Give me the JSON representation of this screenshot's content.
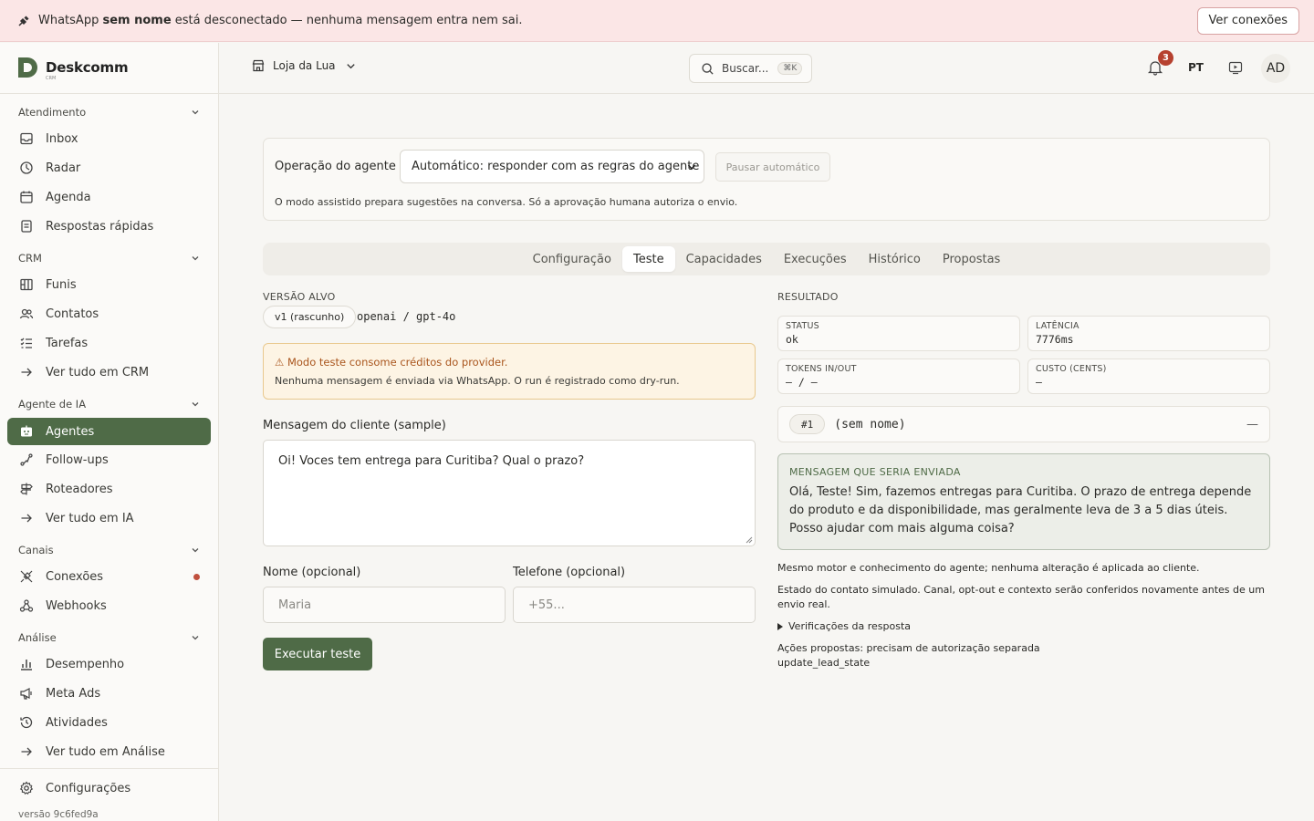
{
  "banner": {
    "prefix": "WhatsApp ",
    "name": "sem nome",
    "suffix": " está desconectado — nenhuma mensagem entra nem sai.",
    "button": "Ver conexões"
  },
  "brand": {
    "name": "Deskcomm",
    "sub": "CRM"
  },
  "sidebar": {
    "sections": [
      {
        "label": "Atendimento",
        "items": [
          {
            "label": "Inbox",
            "icon": "inbox-icon"
          },
          {
            "label": "Radar",
            "icon": "radar-icon"
          },
          {
            "label": "Agenda",
            "icon": "calendar-icon"
          },
          {
            "label": "Respostas rápidas",
            "icon": "document-icon"
          }
        ]
      },
      {
        "label": "CRM",
        "items": [
          {
            "label": "Funis",
            "icon": "kanban-icon"
          },
          {
            "label": "Contatos",
            "icon": "users-icon"
          },
          {
            "label": "Tarefas",
            "icon": "checklist-icon"
          },
          {
            "label": "Ver tudo em CRM",
            "icon": "arrow-right-icon"
          }
        ]
      },
      {
        "label": "Agente de IA",
        "items": [
          {
            "label": "Agentes",
            "icon": "bot-icon",
            "active": true
          },
          {
            "label": "Follow-ups",
            "icon": "route-icon"
          },
          {
            "label": "Roteadores",
            "icon": "signpost-icon"
          },
          {
            "label": "Ver tudo em IA",
            "icon": "arrow-right-icon"
          }
        ]
      },
      {
        "label": "Canais",
        "items": [
          {
            "label": "Conexões",
            "icon": "unplug-icon",
            "alert": true
          },
          {
            "label": "Webhooks",
            "icon": "webhook-icon"
          }
        ]
      },
      {
        "label": "Análise",
        "items": [
          {
            "label": "Desempenho",
            "icon": "bar-chart-icon"
          },
          {
            "label": "Meta Ads",
            "icon": "megaphone-icon"
          },
          {
            "label": "Atividades",
            "icon": "history-icon"
          },
          {
            "label": "Ver tudo em Análise",
            "icon": "arrow-right-icon"
          }
        ]
      }
    ],
    "settings": "Configurações",
    "version": "versão 9c6fed9a"
  },
  "topbar": {
    "store": "Loja da Lua",
    "search_placeholder": "Buscar...",
    "search_shortcut": "⌘K",
    "notifications": "3",
    "lang": "PT",
    "avatar": "AD"
  },
  "operation": {
    "label": "Operação do agente",
    "mode": "Automático: responder com as regras do agente",
    "pause": "Pausar automático",
    "help": "O modo assistido prepara sugestões na conversa. Só a aprovação humana autoriza o envio."
  },
  "tabs": [
    "Configuração",
    "Teste",
    "Capacidades",
    "Execuções",
    "Histórico",
    "Propostas"
  ],
  "active_tab": "Teste",
  "test": {
    "target_label": "VERSÃO ALVO",
    "version_chip": "v1 (rascunho)",
    "model": "openai / gpt-4o",
    "warning_title": "⚠ Modo teste consome créditos do provider.",
    "warning_body": "Nenhuma mensagem é enviada via WhatsApp. O run é registrado como dry-run.",
    "sample_label": "Mensagem do cliente (sample)",
    "sample_value": "Oi! Voces tem entrega para Curitiba? Qual o prazo?",
    "name_label": "Nome (opcional)",
    "name_placeholder": "Maria",
    "phone_label": "Telefone (opcional)",
    "phone_placeholder": "+55...",
    "run_button": "Executar teste"
  },
  "result": {
    "label": "RESULTADO",
    "status_k": "STATUS",
    "status_v": "ok",
    "latency_k": "LATÊNCIA",
    "latency_v": "7776ms",
    "tokens_k": "TOKENS IN/OUT",
    "tokens_v": "— / —",
    "cost_k": "CUSTO (CENTS)",
    "cost_v": "—",
    "run_id": "#1",
    "run_name": "(sem nome)",
    "run_dash": "—",
    "message_label": "MENSAGEM QUE SERIA ENVIADA",
    "message": "Olá, Teste! Sim, fazemos entregas para Curitiba. O prazo de entrega depende do produto e da disponibilidade, mas geralmente leva de 3 a 5 dias úteis. Posso ajudar com mais alguma coisa?",
    "note1": "Mesmo motor e conhecimento do agente; nenhuma alteração é aplicada ao cliente.",
    "note2": "Estado do contato simulado. Canal, opt-out e contexto serão conferidos novamente antes de um envio real.",
    "details": "Verificações da resposta",
    "actions_title": "Ações propostas: precisam de autorização separada",
    "action1": "update_lead_state"
  }
}
